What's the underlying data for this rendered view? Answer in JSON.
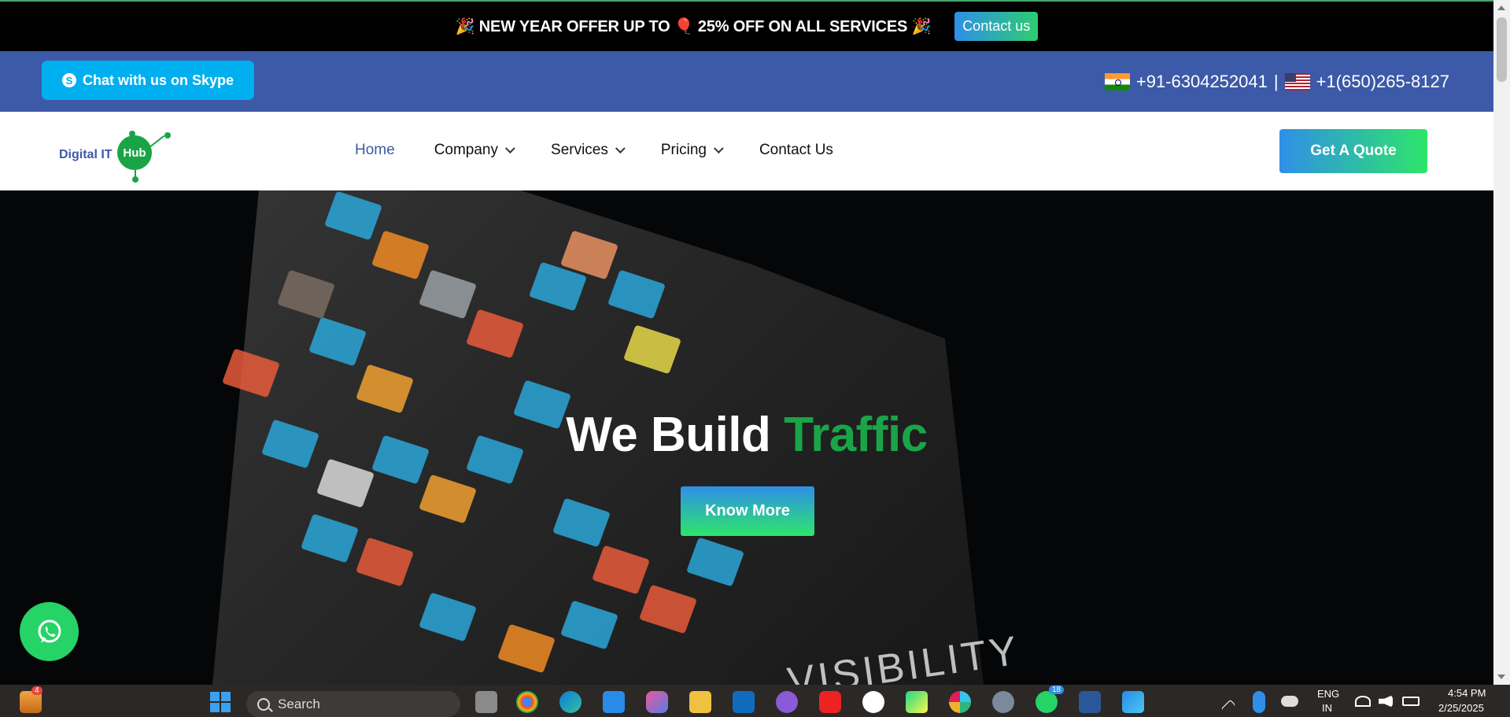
{
  "offer": {
    "text": "🎉 NEW YEAR OFFER UP TO 🎈 25% OFF ON ALL SERVICES 🎉",
    "button": "Contact us"
  },
  "contact": {
    "skype_label": "Chat with us on Skype",
    "phone_in": "+91-6304252041",
    "separator": "|",
    "phone_us": "+1(650)265-8127"
  },
  "logo": {
    "text": "Digital IT",
    "hub": "Hub"
  },
  "nav": {
    "items": [
      {
        "label": "Home",
        "dropdown": false
      },
      {
        "label": "Company",
        "dropdown": true
      },
      {
        "label": "Services",
        "dropdown": true
      },
      {
        "label": "Pricing",
        "dropdown": true
      },
      {
        "label": "Contact Us",
        "dropdown": false
      }
    ],
    "quote_button": "Get A Quote"
  },
  "hero": {
    "title_white": "We Build ",
    "title_green": "Traffic",
    "button": "Know More",
    "overlay_text": "VISIBILITY"
  },
  "taskbar": {
    "search_placeholder": "Search",
    "widget_badge": "4",
    "whatsapp_badge": "18",
    "lang_top": "ENG",
    "lang_bottom": "IN",
    "time": "4:54 PM",
    "date": "2/25/2025"
  },
  "colors": {
    "brand_blue": "#3c5aa8",
    "brand_green": "#19a547",
    "skype": "#00aff0",
    "whatsapp": "#25d366"
  }
}
